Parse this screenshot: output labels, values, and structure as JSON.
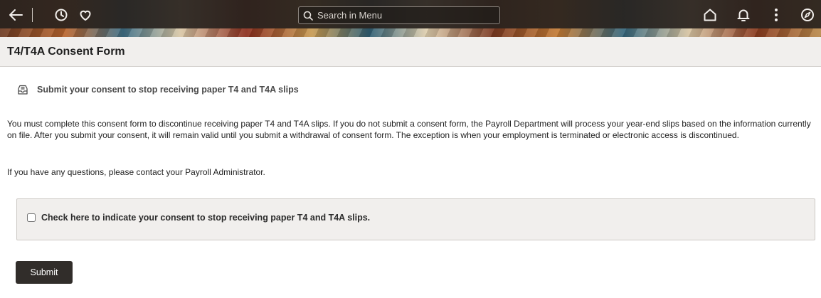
{
  "header": {
    "search": {
      "placeholder": "Search in Menu",
      "value": ""
    },
    "icons": [
      "back-arrow-icon",
      "history-icon",
      "favorites-icon",
      "search-icon",
      "home-icon",
      "notifications-icon",
      "more-actions-icon",
      "navigator-icon"
    ]
  },
  "page": {
    "title": "T4/T4A Consent Form",
    "subtitle": "Submit your consent to stop receiving paper T4 and T4A slips",
    "paragraph1": "You must complete this consent form to discontinue receiving paper T4 and T4A slips. If you do not submit a consent form, the Payroll Department will process your year-end slips based on the information currently on file. After you submit your consent, it will remain valid until you submit a withdrawal of consent form. The exception is when your employment is terminated or electronic access is discontinued.",
    "paragraph2": "If you have any questions, please contact your Payroll Administrator.",
    "consent": {
      "label": "Check here to indicate your consent to stop receiving paper T4 and T4A slips.",
      "checked": false
    },
    "submit_label": "Submit"
  },
  "colors": {
    "header_dark": "#2b2522",
    "title_bar": "#f1efed",
    "button": "#312d2a"
  }
}
